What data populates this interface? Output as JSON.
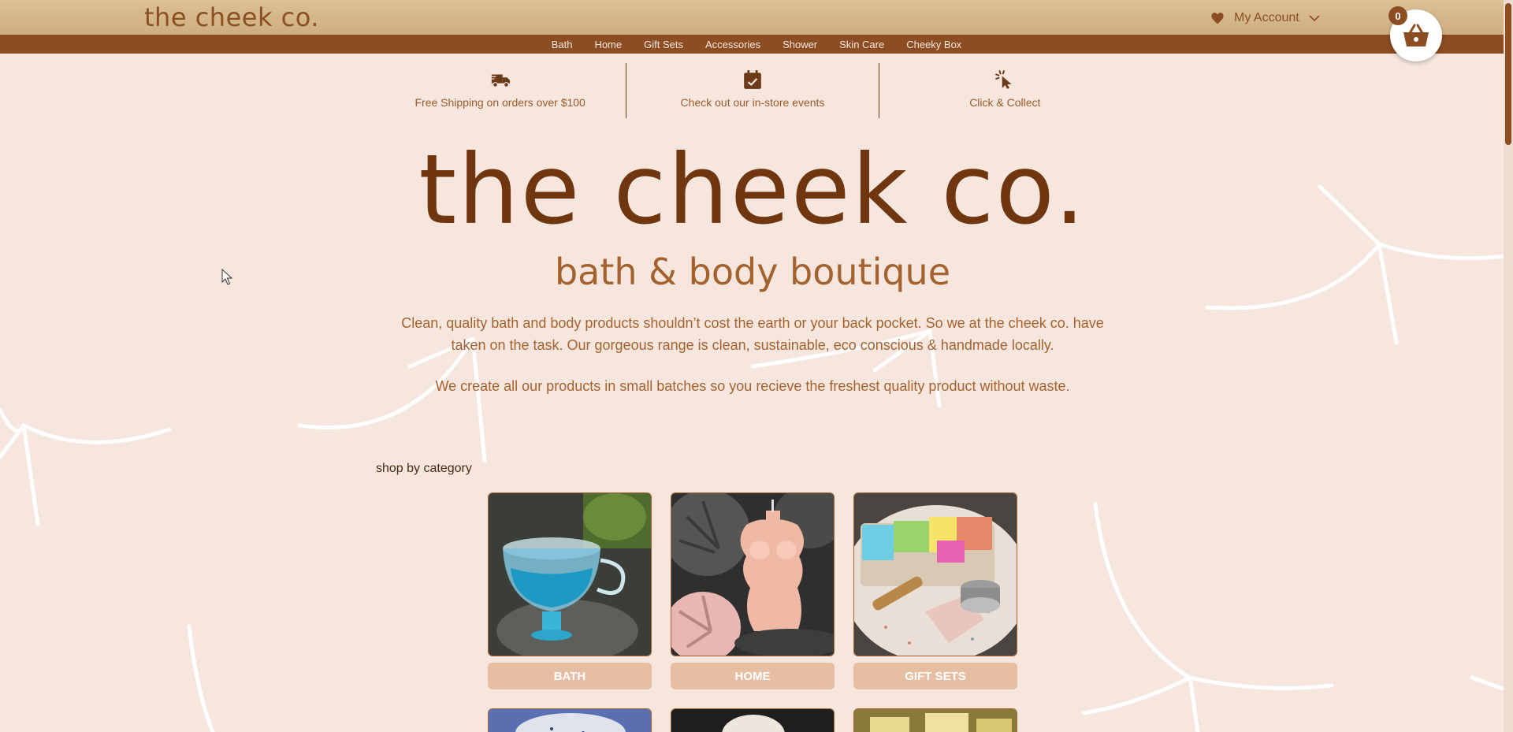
{
  "brand": {
    "logo_text": "the cheek co."
  },
  "header": {
    "account_label": "My Account",
    "cart_count": "0"
  },
  "nav": {
    "items": [
      "Bath",
      "Home",
      "Gift Sets",
      "Accessories",
      "Shower",
      "Skin Care",
      "Cheeky Box"
    ]
  },
  "features": [
    {
      "icon": "truck-icon",
      "text": "Free Shipping on orders over $100"
    },
    {
      "icon": "calendar-check-icon",
      "text": "Check out our in-store events"
    },
    {
      "icon": "pointer-click-icon",
      "text": "Click & Collect"
    }
  ],
  "hero": {
    "title": "the cheek co.",
    "subtitle": "bath & body boutique",
    "paragraph1": "Clean, quality bath and body products shouldn’t cost the earth or your back pocket. So we at the cheek co. have taken on the task. Our gorgeous range is clean, sustainable, eco conscious & handmade locally.",
    "paragraph2": "We create all our products in small batches so you recieve the freshest quality product without waste."
  },
  "categories": {
    "section_title": "shop by category",
    "items": [
      {
        "label": "BATH"
      },
      {
        "label": "HOME"
      },
      {
        "label": "GIFT SETS"
      }
    ]
  },
  "colors": {
    "brand_brown": "#8c4d22",
    "background": "#f6e6dd",
    "button_tan": "#e6bfa2"
  }
}
